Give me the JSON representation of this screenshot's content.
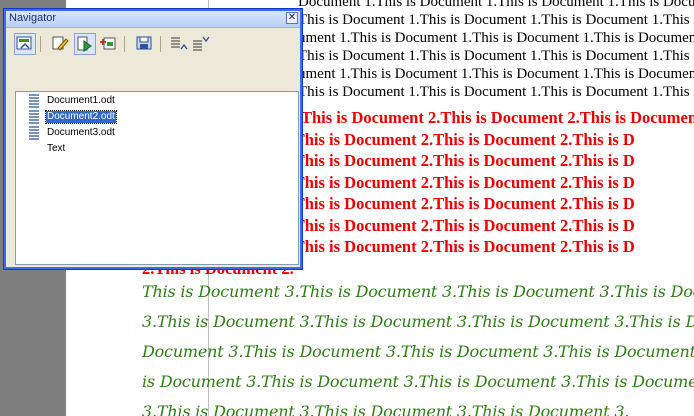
{
  "navigator": {
    "title": "Navigator",
    "toolbar": [
      {
        "name": "toggle-master-view-icon"
      },
      {
        "name": "edit-icon"
      },
      {
        "name": "update-icon"
      },
      {
        "name": "insert-icon"
      },
      {
        "name": "save-contents-icon"
      },
      {
        "name": "move-up-icon"
      },
      {
        "name": "move-down-icon"
      }
    ],
    "tree": [
      {
        "label": "Document1.odt",
        "icon": "document-icon",
        "selected": false
      },
      {
        "label": "Document2.odt",
        "icon": "document-icon",
        "selected": true
      },
      {
        "label": "Document3.odt",
        "icon": "document-icon",
        "selected": false
      },
      {
        "label": "Text",
        "icon": "",
        "selected": false
      }
    ]
  },
  "document": {
    "doc1_lines": [
      "Document 1.This is Document 1.This is Document 1.This is Document 1.This is",
      "This is Document 1.This is Document 1.This is Document 1.This is Document 1.This is",
      "ument 1.This is Document 1.This is Document 1.This is Document 1.This is Document",
      "This is Document 1.This is Document 1.This is Document 1.This is Document 1.This is",
      "ument 1.This is Document 1.This is Document 1.This is Document 1.This is Document",
      "This is Document 1.This is Document 1.This is Document 1.This is Document 1.This is"
    ],
    "doc2_lines": [
      "This is Document 2.This is Document 2.This is Document 2.This is Do",
      "2.This is Document 2.This is Document 2.This is Document 2.This is D",
      "2.This is Document 2.This is Document 2.This is Document 2.This is D",
      "2.This is Document 2.This is Document 2.This is Document 2.This is D",
      "2.This is Document 2.This is Document 2.This is Document 2.This is D",
      "2.This is Document 2.This is Document 2.This is Document 2.This is D",
      "2.This is Document 2.This is Document 2.This is Document 2.This is D",
      "2.This is Document 2."
    ],
    "doc3_lines": [
      "This is Document 3.This is Document 3.This is Document 3.This is Document 3",
      "3.This is Document 3.This is Document 3.This is Document 3.This is Document",
      "Document 3.This is Document 3.This is Document 3.This is Document 3.This is",
      "is Document 3.This is Document 3.This is Document 3.This is Document 3.This",
      "3.This is Document 3.This is Document 3.This is Document 3."
    ]
  }
}
